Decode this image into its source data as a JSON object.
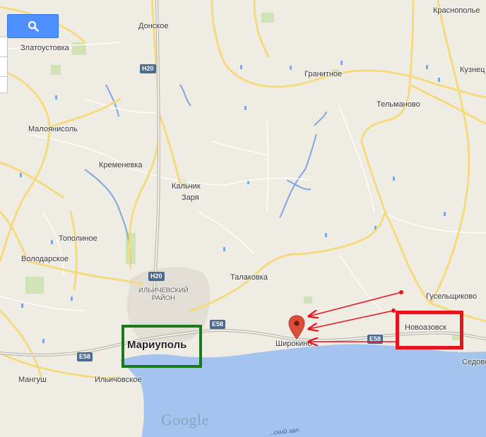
{
  "map": {
    "search_button": {
      "icon": "search-icon"
    },
    "places": [
      {
        "name": "Краснополье"
      },
      {
        "name": "Донское"
      },
      {
        "name": "Златоустовка"
      },
      {
        "name": "Гранитное"
      },
      {
        "name": "Кузнец"
      },
      {
        "name": "Тельманово"
      },
      {
        "name": "Малоянисоль"
      },
      {
        "name": "Кременевка"
      },
      {
        "name": "Кальчик"
      },
      {
        "name": "Заря"
      },
      {
        "name": "Тополиное"
      },
      {
        "name": "Володарское"
      },
      {
        "name": "Талаковка"
      },
      {
        "name": "Гусельщиково"
      },
      {
        "name": "Новоазовск"
      },
      {
        "name": "Мариуполь"
      },
      {
        "name": "Широкино"
      },
      {
        "name": "Седово"
      },
      {
        "name": "Мангуш"
      },
      {
        "name": "Ильичовское"
      }
    ],
    "district": {
      "line1": "ИЛЬИЧЕВСКИЙ",
      "line2": "РАЙОН"
    },
    "road_shields": [
      {
        "label": "H20"
      },
      {
        "label": "H20"
      },
      {
        "label": "E58"
      },
      {
        "label": "E58"
      },
      {
        "label": "E58"
      }
    ],
    "sea_label": "...ский зал.",
    "logo": "Google",
    "annotations": {
      "green_box_color": "#1a7a1a",
      "red_box_color": "#e8141b",
      "arrow_color": "#e8141b",
      "marker_color": "#dd4b39"
    }
  }
}
